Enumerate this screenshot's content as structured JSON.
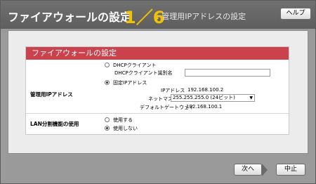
{
  "header": {
    "title": "ファイアウォールの設定",
    "step": "1／6",
    "step_description": ": 管理用IPアドレスの設定",
    "help_button": "ヘルプ"
  },
  "panel": {
    "heading": "ファイアウォールの設定",
    "management_ip": {
      "label": "管理用IPアドレス",
      "dhcp_option": "DHCPクライアント",
      "dhcp_id_label": "DHCPクライアント識別名",
      "dhcp_id_value": "",
      "static_option": "固定IPアドレス",
      "ip_label": "IPアドレス",
      "ip_value": "192.168.100.2",
      "netmask_label": "ネットマスク",
      "netmask_value": "255.255.255.0 (24ビット)",
      "gateway_label": "デフォルトゲートウェイ",
      "gateway_value": "192.168.100.1",
      "selected": "static"
    },
    "lan_split": {
      "label": "LAN分割機能の使用",
      "use_option": "使用する",
      "nouse_option": "使用しない",
      "selected": "nouse"
    }
  },
  "footer": {
    "next_button": "次へ",
    "cancel_button": "中止"
  }
}
